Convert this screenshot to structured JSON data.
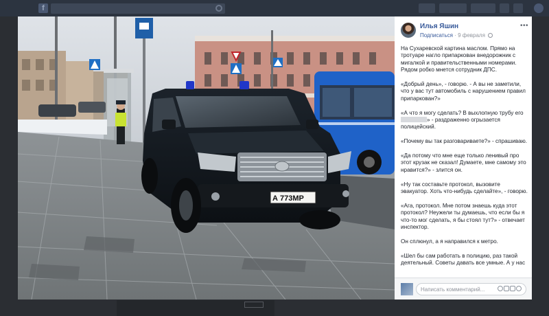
{
  "post": {
    "author": "Илья Яшин",
    "subscribe": "Подписаться",
    "date": "9 февраля",
    "paragraphs": [
      "На Сухаревской картина маслом. Прямо на тротуаре нагло припаркован внедорожник с мигалкой и правительственными номерами. Рядом робко мнется сотрудник ДПС.",
      "«Добрый день», - говорю. - А вы не заметили, что у вас тут автомобиль с нарушением правил припаркован?»",
      "«А что я могу сделать? В выхлопную трубу его",
      "» - раздраженно огрызается полицейский.",
      "«Почему вы так разговариваете?» - спрашиваю.",
      "«Да потому что мне еще только ленивый про этот крузак не сказал! Думаете, мне самому это нравится?» - злится он.",
      "«Ну так составьте протокол, вызовите эвакуатор. Хоть что-нибудь сделайте», - говорю.",
      "«Ага, протокол. Мне потом знаешь куда этот протокол? Неужели ты думаешь, что если бы я что-то мог сделать, я бы стоял тут?» - отвечает инспектор.",
      "Он сплюнул, а я направился к метро.",
      "«Шел бы сам работать в полицию, раз такой деятельный. Советы давать все умные. А у нас"
    ]
  },
  "comment": {
    "placeholder": "Написать комментарий..."
  },
  "photo": {
    "plate": "А 773МР"
  },
  "icons": [
    "facebook-logo-icon",
    "search-icon",
    "globe-icon",
    "more-icon",
    "emoji-icon",
    "camera-icon",
    "gif-icon",
    "sticker-icon"
  ]
}
